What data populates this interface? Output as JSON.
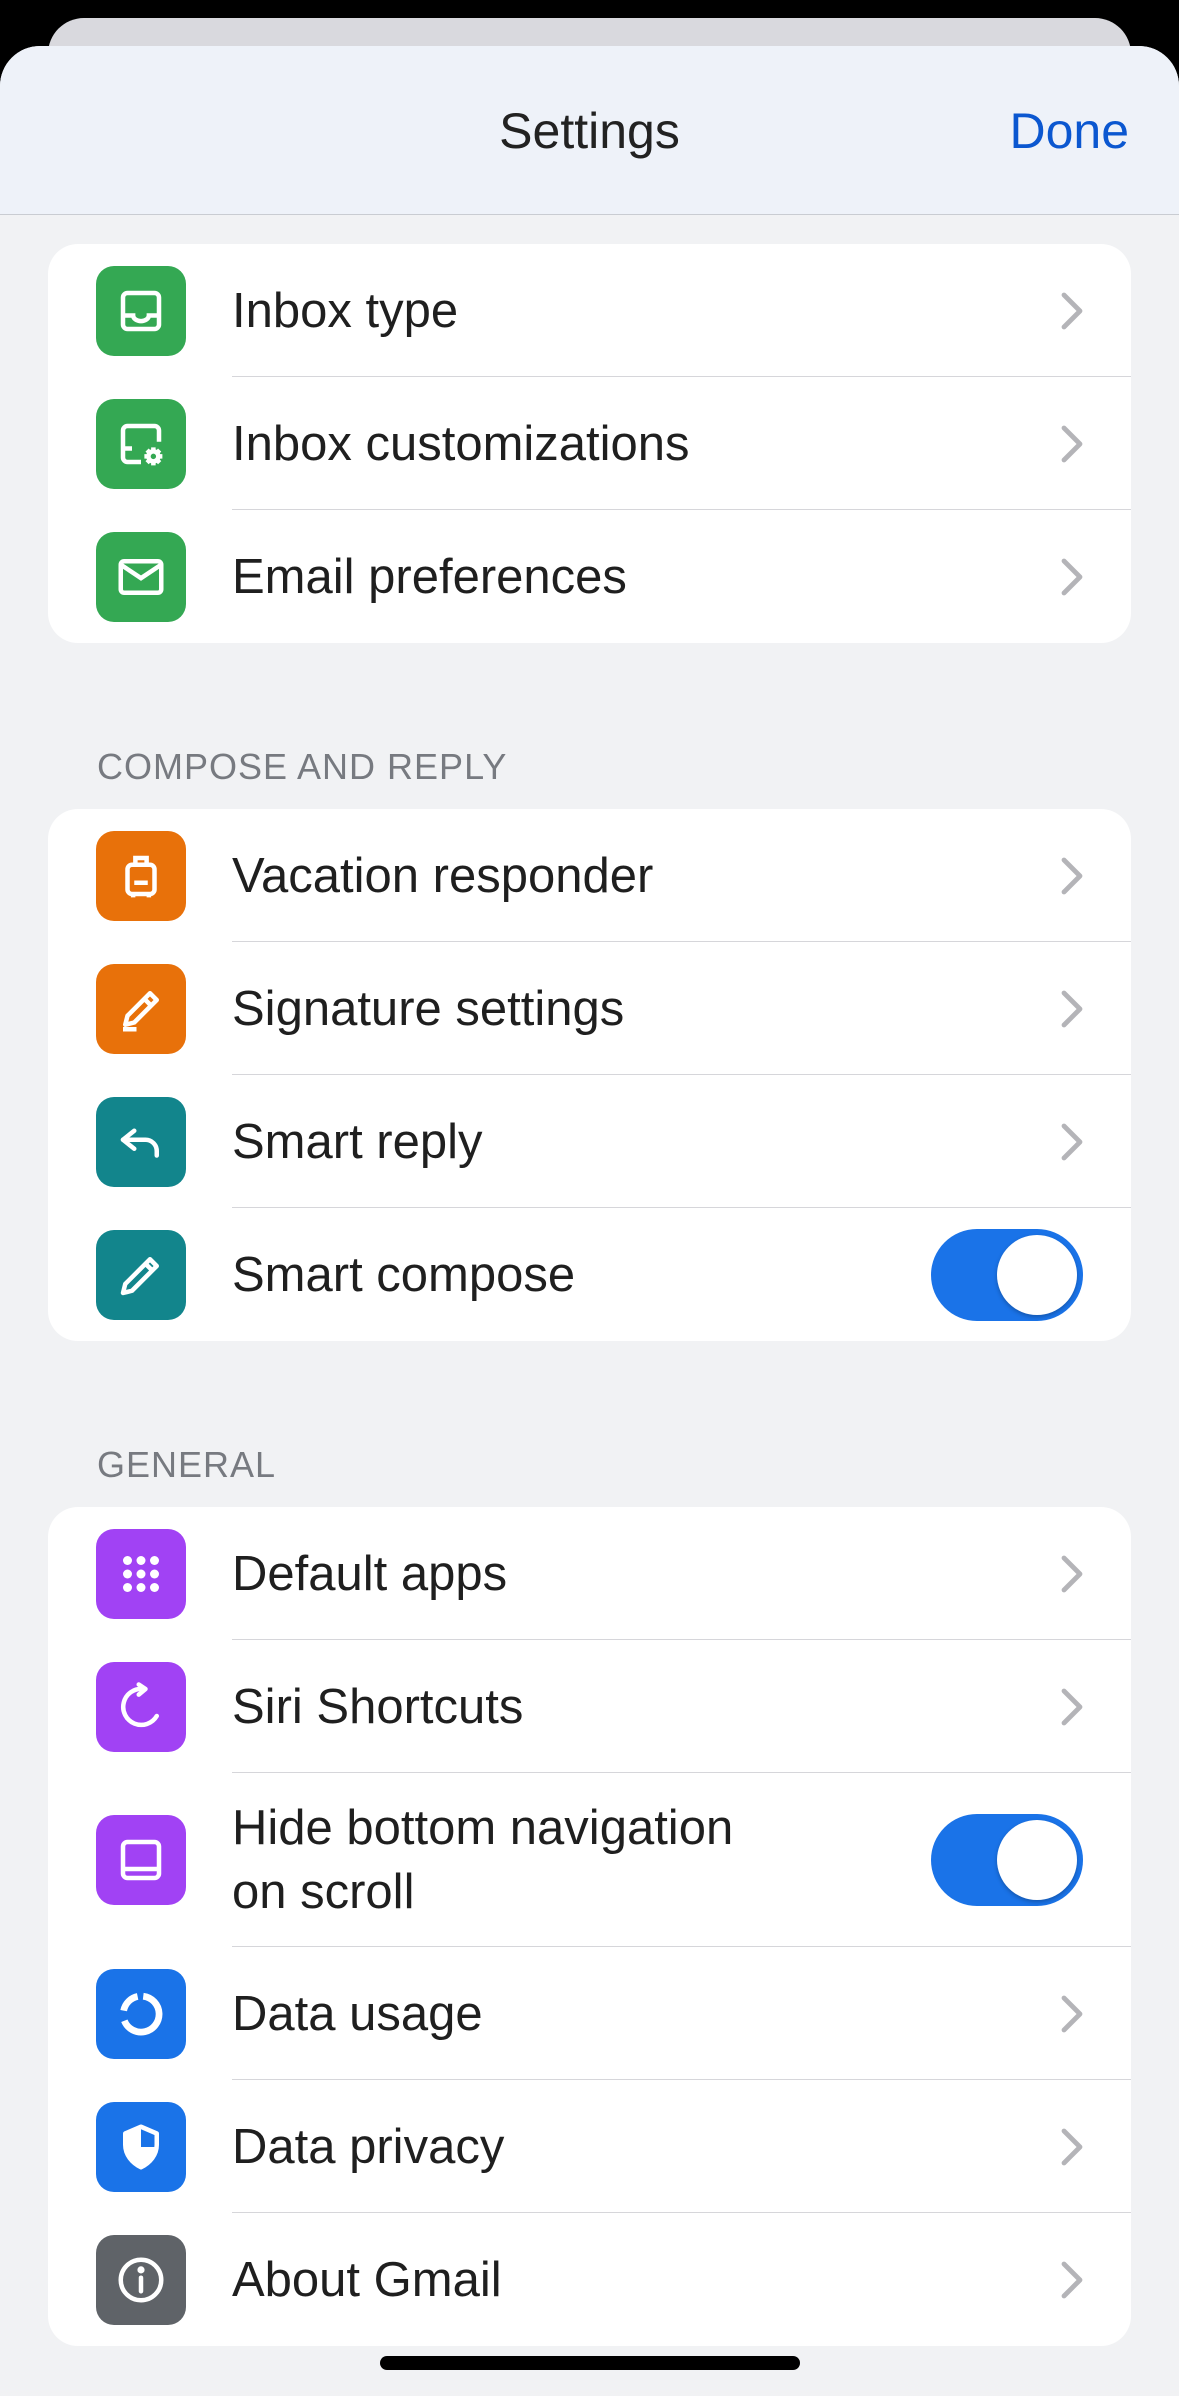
{
  "nav": {
    "title": "Settings",
    "done_label": "Done"
  },
  "groups": [
    {
      "header": "",
      "rows": [
        {
          "label": "Inbox type",
          "icon": "inbox-icon",
          "color": "#34a853",
          "accessory": "chevron"
        },
        {
          "label": "Inbox customizations",
          "icon": "inbox-settings-icon",
          "color": "#34a853",
          "accessory": "chevron"
        },
        {
          "label": "Email preferences",
          "icon": "mail-icon",
          "color": "#34a853",
          "accessory": "chevron"
        }
      ]
    },
    {
      "header": "COMPOSE AND REPLY",
      "rows": [
        {
          "label": "Vacation responder",
          "icon": "luggage-icon",
          "color": "#e8710a",
          "accessory": "chevron"
        },
        {
          "label": "Signature settings",
          "icon": "signature-pen-icon",
          "color": "#e8710a",
          "accessory": "chevron"
        },
        {
          "label": "Smart reply",
          "icon": "reply-icon",
          "color": "#12858c",
          "accessory": "chevron"
        },
        {
          "label": "Smart compose",
          "icon": "pencil-icon",
          "color": "#12858c",
          "accessory": "toggle",
          "toggle_on": true
        }
      ]
    },
    {
      "header": "GENERAL",
      "rows": [
        {
          "label": "Default apps",
          "icon": "apps-grid-icon",
          "color": "#a142f4",
          "accessory": "chevron"
        },
        {
          "label": "Siri Shortcuts",
          "icon": "shortcut-icon",
          "color": "#a142f4",
          "accessory": "chevron"
        },
        {
          "label_line1": "Hide bottom navigation",
          "label_line2": "on scroll",
          "icon": "bottom-nav-icon",
          "color": "#a142f4",
          "accessory": "toggle",
          "toggle_on": true
        },
        {
          "label": "Data usage",
          "icon": "data-usage-icon",
          "color": "#1a73e8",
          "accessory": "chevron"
        },
        {
          "label": "Data privacy",
          "icon": "shield-icon",
          "color": "#1a73e8",
          "accessory": "chevron"
        },
        {
          "label": "About Gmail",
          "icon": "info-icon",
          "color": "#5f6368",
          "accessory": "chevron"
        }
      ]
    }
  ]
}
